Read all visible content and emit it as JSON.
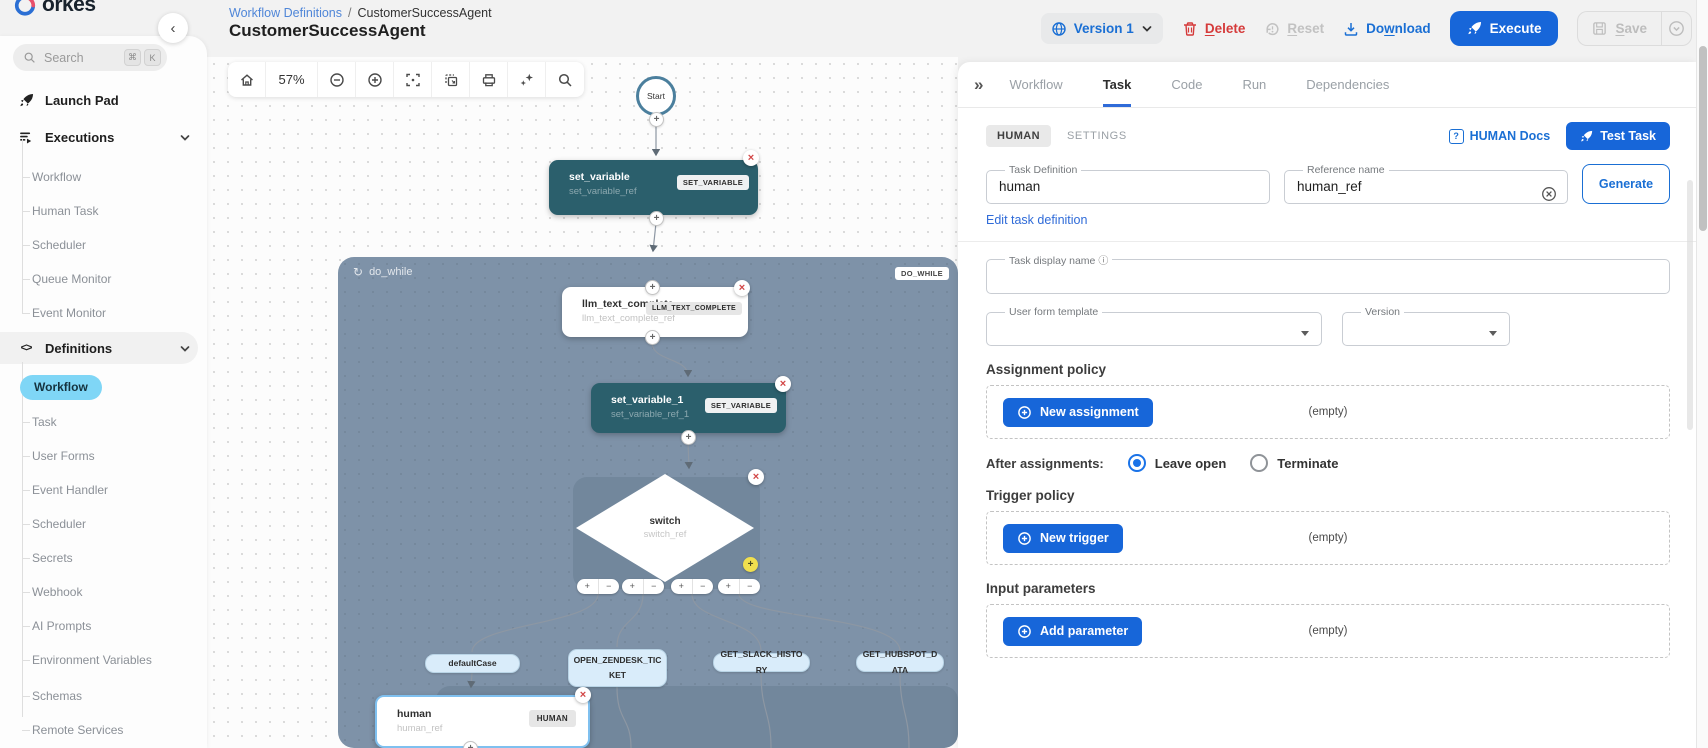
{
  "icons": {
    "collapse_left": "‹",
    "panel_expand": "»",
    "cmd": "⌘",
    "k_key": "K",
    "code_brackets": "<>",
    "loop": "↻",
    "plus": "+",
    "minus": "−",
    "close": "×",
    "question": "?",
    "info": "ⓘ",
    "slash": "/"
  },
  "sidebar": {
    "logo_text": "orkes",
    "search_placeholder": "Search",
    "launch_pad": "Launch Pad",
    "executions": {
      "label": "Executions",
      "items": [
        "Workflow",
        "Human Task",
        "Scheduler",
        "Queue Monitor",
        "Event Monitor"
      ]
    },
    "definitions": {
      "label": "Definitions",
      "active_item": "Workflow",
      "items": [
        "Workflow",
        "Task",
        "User Forms",
        "Event Handler",
        "Scheduler",
        "Secrets",
        "Webhook",
        "AI Prompts",
        "Environment Variables",
        "Schemas",
        "Remote Services"
      ]
    }
  },
  "header": {
    "breadcrumb_link": "Workflow Definitions",
    "breadcrumb_current": "CustomerSuccessAgent",
    "title": "CustomerSuccessAgent",
    "version_label": "Version 1",
    "delete": {
      "key": "D",
      "rest": "elete"
    },
    "reset": {
      "key": "R",
      "rest": "eset"
    },
    "download": {
      "pre": "Do",
      "key": "w",
      "rest": "nload"
    },
    "execute": {
      "key": "E",
      "rest": "xecute"
    },
    "save": {
      "key": "S",
      "rest": "ave"
    }
  },
  "canvas": {
    "zoom_level": "57%",
    "start_label": "Start",
    "nodes": {
      "set_variable": {
        "name": "set_variable",
        "ref": "set_variable_ref",
        "type": "SET_VARIABLE"
      },
      "do_while": {
        "name": "do_while",
        "type": "DO_WHILE"
      },
      "llm": {
        "name": "llm_text_complete",
        "ref": "llm_text_complete_ref",
        "type": "LLM_TEXT_COMPLETE"
      },
      "set_variable_1": {
        "name": "set_variable_1",
        "ref": "set_variable_ref_1",
        "type": "SET_VARIABLE"
      },
      "switch": {
        "name": "switch",
        "ref": "switch_ref"
      },
      "human": {
        "name": "human",
        "ref": "human_ref",
        "type": "HUMAN"
      }
    },
    "cases": [
      "defaultCase",
      "OPEN_ZENDESK_TICKET",
      "GET_SLACK_HISTORY",
      "GET_HUBSPOT_DATA"
    ]
  },
  "panel": {
    "tabs": [
      "Workflow",
      "Task",
      "Code",
      "Run",
      "Dependencies"
    ],
    "active_tab": "Task",
    "subtab_active": "HUMAN",
    "subtab_settings": "SETTINGS",
    "docs_link": "HUMAN Docs",
    "test_task": "Test Task",
    "task_definition": {
      "label": "Task Definition",
      "value": "human"
    },
    "reference_name": {
      "label": "Reference name",
      "value": "human_ref"
    },
    "generate": "Generate",
    "edit_link": "Edit task definition",
    "display_name_label": "Task display name",
    "user_form_label": "User form template",
    "version_field_label": "Version",
    "assignment": {
      "heading": "Assignment policy",
      "button": "New assignment",
      "empty": "(empty)"
    },
    "after": {
      "label": "After assignments:",
      "leave_open": "Leave open",
      "terminate": "Terminate",
      "selected": "Leave open"
    },
    "trigger": {
      "heading": "Trigger policy",
      "button": "New trigger",
      "empty": "(empty)"
    },
    "params": {
      "heading": "Input parameters",
      "button": "Add parameter",
      "empty": "(empty)"
    }
  },
  "colors": {
    "accent_blue": "#1a6fd4",
    "node_teal": "#2b5f6c",
    "container_slate": "#7e92a8",
    "inner_slate": "#72879c",
    "active_cyan": "#7fd6f6",
    "danger_red": "#d53b3b",
    "case_pill_blue": "#d9ecfa",
    "warning_yellow": "#f0df4e"
  }
}
